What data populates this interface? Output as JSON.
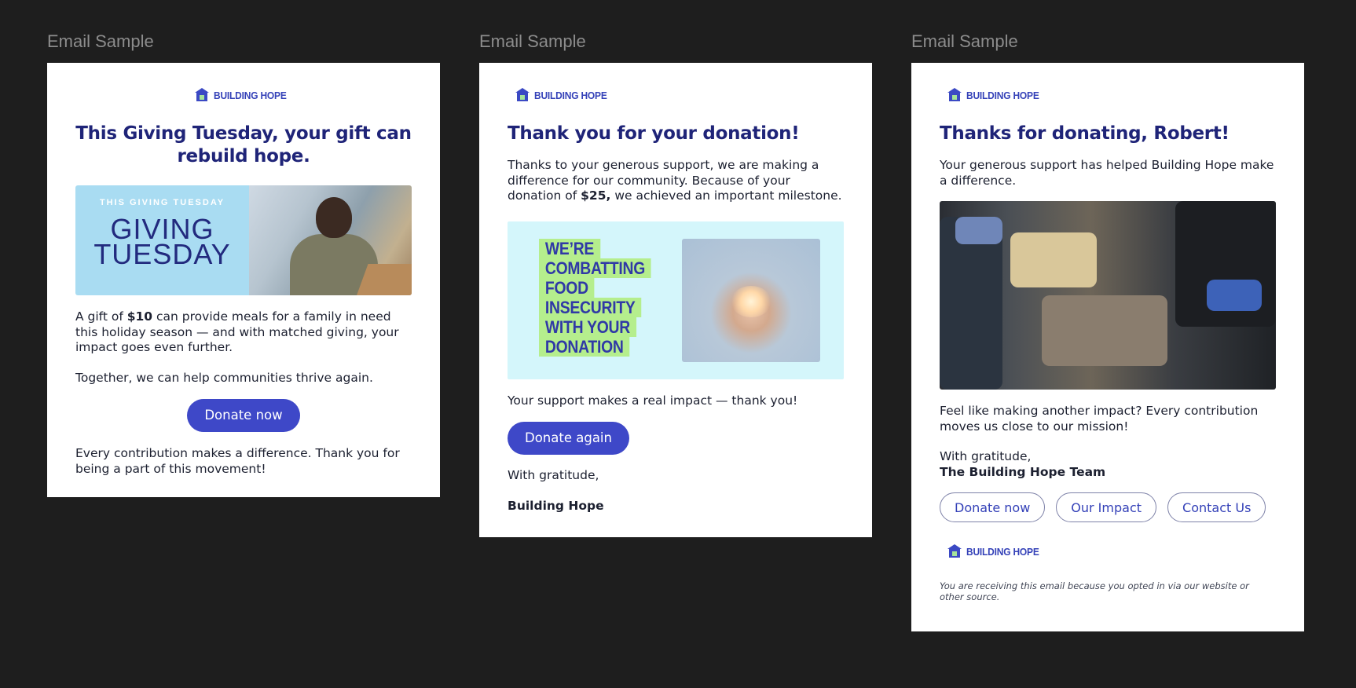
{
  "frames": [
    {
      "label": "Email Sample",
      "logo_text": "BUILDING HOPE",
      "headline": "This Giving Tuesday, your gift can rebuild hope.",
      "banner": {
        "small_text": "THIS GIVING TUESDAY",
        "big_line1": "GIVING",
        "big_line2": "TUESDAY"
      },
      "para1_pre": "A gift of ",
      "para1_bold": "$10",
      "para1_post": " can provide meals for a family in need this holiday season — and with matched giving, your impact goes even further.",
      "para2": "Together, we can help communities thrive again.",
      "button": "Donate now",
      "closing": "Every contribution makes a difference. Thank you for being a part of this movement!"
    },
    {
      "label": "Email Sample",
      "logo_text": "BUILDING HOPE",
      "headline": "Thank you for your donation!",
      "para1_pre": "Thanks to your generous support, we are making a difference for our community. Because of your donation of ",
      "para1_bold": "$25,",
      "para1_post": " we achieved an important milestone.",
      "banner_lines": [
        "WE’RE",
        "COMBATTING",
        "FOOD",
        "INSECURITY",
        "WITH YOUR",
        "DONATION"
      ],
      "para2": "Your support makes a real impact — thank you!",
      "button": "Donate again",
      "sign_off": "With gratitude,",
      "signature": "Building Hope"
    },
    {
      "label": "Email Sample",
      "logo_text": "BUILDING HOPE",
      "headline": "Thanks for donating, Robert!",
      "para1": "Your generous support has helped Building Hope make a difference.",
      "para2": "Feel like making another impact? Every contribution moves us close to our mission!",
      "sign_off": "With gratitude,",
      "signature": "The Building Hope Team",
      "buttons": [
        "Donate now",
        "Our Impact",
        "Contact Us"
      ],
      "footer_logo_text": "BUILDING HOPE",
      "fine_print": "You are receiving this email because you opted in via our website or other source."
    }
  ],
  "colors": {
    "background": "#1e1e1e",
    "headline": "#1f2478",
    "button": "#3e48c8",
    "banner_blue": "#a9dcf2",
    "banner_green": "#b5ee8d",
    "banner_cyan": "#d4f6fb"
  }
}
